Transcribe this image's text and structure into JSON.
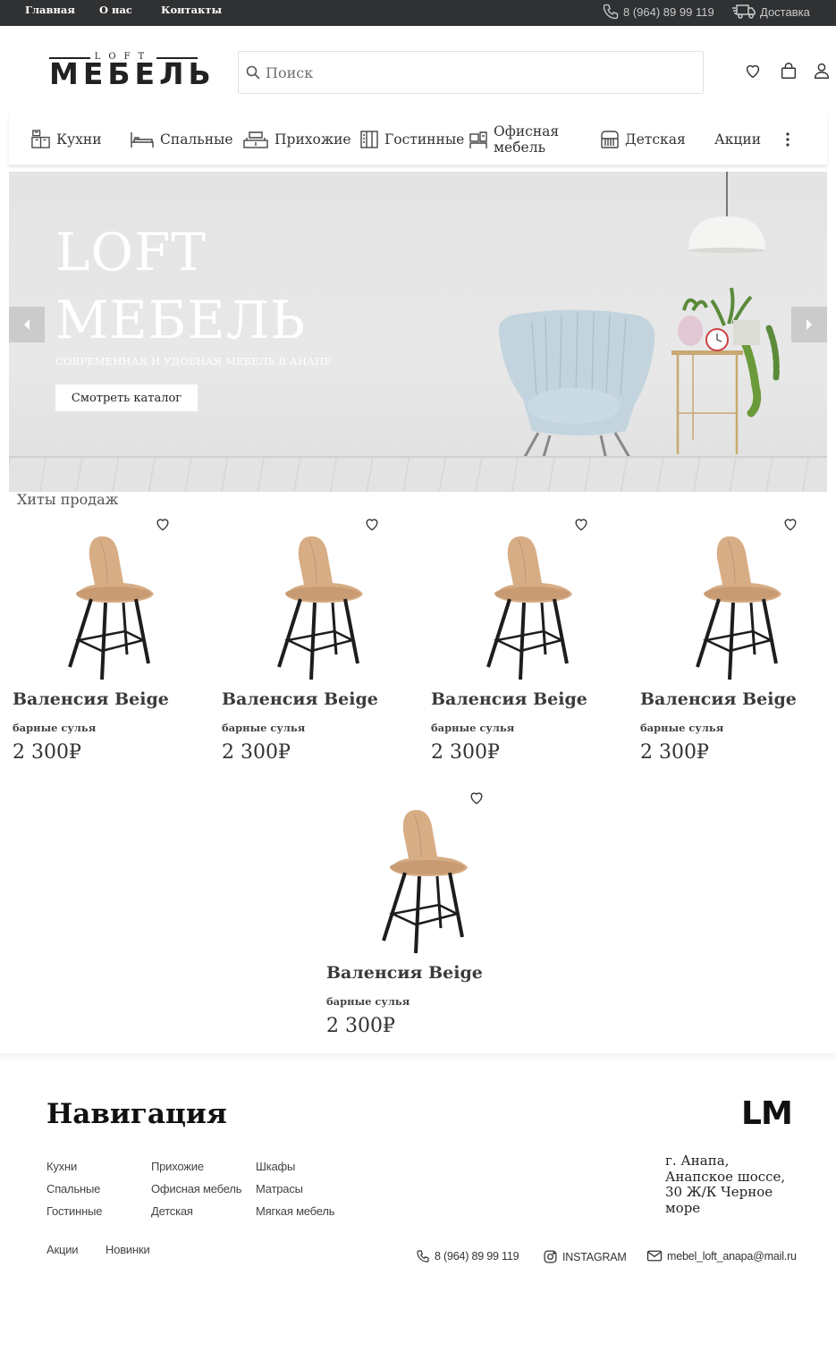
{
  "topbar": {
    "links": [
      "Главная",
      "О нас",
      "Контакты"
    ],
    "phone": "8 (964) 89 99 119",
    "delivery": "Доставка"
  },
  "logo": {
    "top": "LOFT",
    "main": "МЕБЕЛЬ"
  },
  "search": {
    "placeholder": "Поиск",
    "icon": "search-icon"
  },
  "header_icons": [
    "heart-icon",
    "bag-icon",
    "user-icon"
  ],
  "categories": [
    {
      "label": "Кухни",
      "icon": "kitchen-icon"
    },
    {
      "label": "Спальные",
      "icon": "bed-icon"
    },
    {
      "label": "Прихожие",
      "icon": "hallway-icon"
    },
    {
      "label": "Гостинные",
      "icon": "wardrobe-icon"
    },
    {
      "label": "Офисная мебель",
      "icon": "office-icon"
    },
    {
      "label": "Детская",
      "icon": "crib-icon"
    },
    {
      "label": "Акции",
      "icon": ""
    }
  ],
  "hero": {
    "title_line1": "LOFT",
    "title_line2": "МЕБЕЛЬ",
    "subtitle": "СОВРЕМЕННАЯ И УДОБНАЯ МЕБЕЛЬ В АНАПЕ",
    "button": "Смотреть каталог"
  },
  "hits": {
    "title": "Хиты продаж",
    "products": [
      {
        "name": "Валенсия Beige",
        "type": "барные сулья",
        "price": "2 300₽"
      },
      {
        "name": "Валенсия Beige",
        "type": "барные сулья",
        "price": "2 300₽"
      },
      {
        "name": "Валенсия Beige",
        "type": "барные сулья",
        "price": "2 300₽"
      },
      {
        "name": "Валенсия Beige",
        "type": "барные сулья",
        "price": "2 300₽"
      },
      {
        "name": "Валенсия Beige",
        "type": "барные сулья",
        "price": "2 300₽"
      }
    ]
  },
  "footer": {
    "title": "Навигация",
    "columns": [
      [
        "Кухни",
        "Спальные",
        "Гостинные"
      ],
      [
        "Прихожие",
        "Офисная мебель",
        "Детская"
      ],
      [
        "Шкафы",
        "Матрасы",
        "Мягкая мебель"
      ]
    ],
    "extra_links": [
      "Акции",
      "Новинки"
    ],
    "logo": "LM",
    "address": "г. Анапа, Анапское шоссе, 30 Ж/К Черное море",
    "phone": "8 (964) 89 99 119",
    "instagram": "INSTAGRAM",
    "email": "mebel_loft_anapa@mail.ru"
  },
  "colors": {
    "topbar": "#2f3133",
    "text": "#222222",
    "accent": "#ffffff",
    "seat": "#d7ad86"
  }
}
